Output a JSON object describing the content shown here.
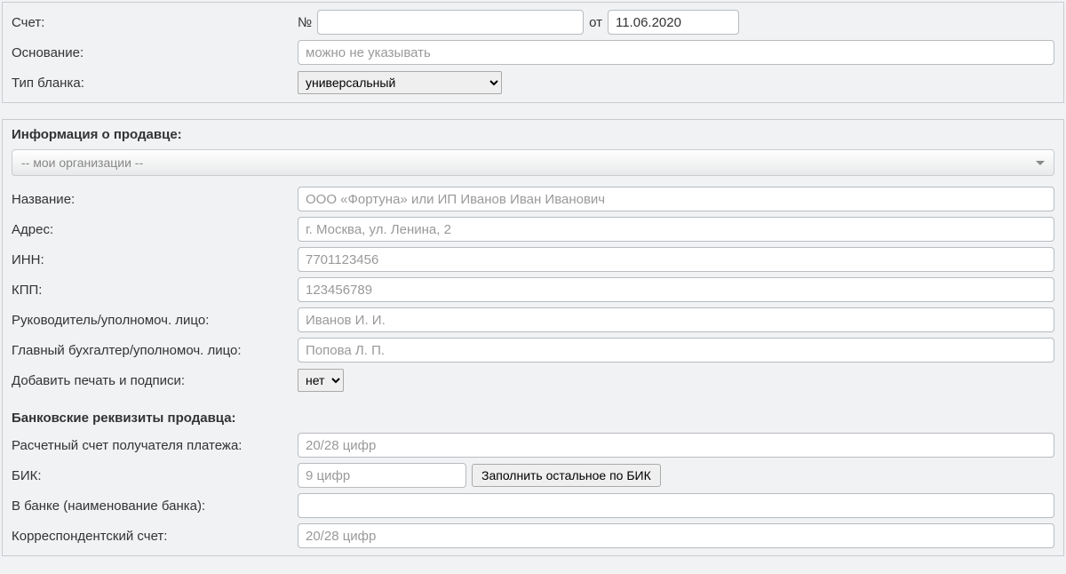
{
  "invoice": {
    "label": "Счет:",
    "number_prefix": "№",
    "number_value": "",
    "date_prefix": "от",
    "date_value": "11.06.2020"
  },
  "basis": {
    "label": "Основание:",
    "placeholder": "можно не указывать",
    "value": ""
  },
  "form_type": {
    "label": "Тип бланка:",
    "selected": "универсальный",
    "options": [
      "универсальный"
    ]
  },
  "seller_section": {
    "title": "Информация о продавце:",
    "org_dropdown": "-- мои организации --",
    "name": {
      "label": "Название:",
      "placeholder": "ООО «Фортуна» или ИП Иванов Иван Иванович",
      "value": ""
    },
    "address": {
      "label": "Адрес:",
      "placeholder": "г. Москва, ул. Ленина, 2",
      "value": ""
    },
    "inn": {
      "label": "ИНН:",
      "placeholder": "7701123456",
      "value": ""
    },
    "kpp": {
      "label": "КПП:",
      "placeholder": "123456789",
      "value": ""
    },
    "director": {
      "label": "Руководитель/уполномоч. лицо:",
      "placeholder": "Иванов И. И.",
      "value": ""
    },
    "accountant": {
      "label": "Главный бухгалтер/уполномоч. лицо:",
      "placeholder": "Попова Л. П.",
      "value": ""
    },
    "stamp": {
      "label": "Добавить печать и подписи:",
      "selected": "нет",
      "options": [
        "нет"
      ]
    }
  },
  "bank_section": {
    "title": "Банковские реквизиты продавца:",
    "account": {
      "label": "Расчетный счет получателя платежа:",
      "placeholder": "20/28 цифр",
      "value": ""
    },
    "bik": {
      "label": "БИК:",
      "placeholder": "9 цифр",
      "value": "",
      "button": "Заполнить остальное по БИК"
    },
    "bank_name": {
      "label": "В банке (наименование банка):",
      "placeholder": "",
      "value": ""
    },
    "corr_account": {
      "label": "Корреспондентский счет:",
      "placeholder": "20/28 цифр",
      "value": ""
    }
  }
}
